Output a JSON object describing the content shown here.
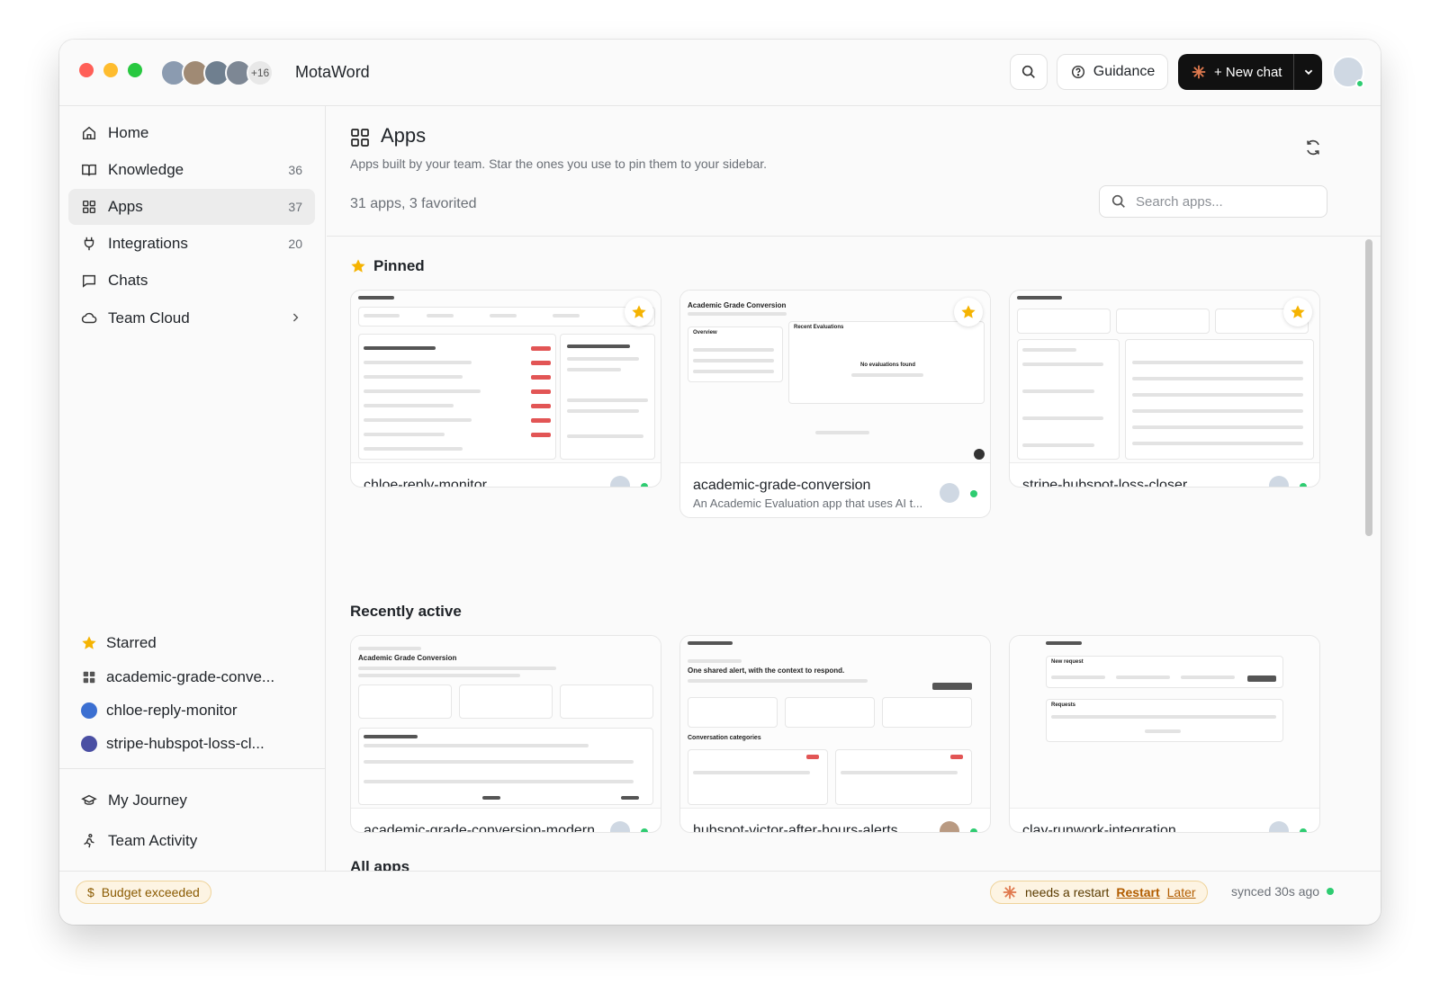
{
  "window": {
    "traffic_lights": [
      "close",
      "minimize",
      "zoom"
    ],
    "team_extra_count": "+16",
    "app_name": "MotaWord"
  },
  "toolbar": {
    "search_icon": "search-icon",
    "guidance_label": "Guidance",
    "new_chat_label": "+ New chat"
  },
  "sidebar": {
    "items": [
      {
        "label": "Home",
        "icon": "home-icon",
        "count": ""
      },
      {
        "label": "Knowledge",
        "icon": "book-icon",
        "count": "36"
      },
      {
        "label": "Apps",
        "icon": "grid-icon",
        "count": "37"
      },
      {
        "label": "Integrations",
        "icon": "plug-icon",
        "count": "20"
      },
      {
        "label": "Chats",
        "icon": "chat-icon",
        "count": ""
      },
      {
        "label": "Team Cloud",
        "icon": "cloud-icon",
        "count": ""
      }
    ],
    "starred_title": "Starred",
    "starred": [
      {
        "label": "academic-grade-conve...",
        "icon": "grid-icon"
      },
      {
        "label": "chloe-reply-monitor",
        "icon": "app-badge-icon"
      },
      {
        "label": "stripe-hubspot-loss-cl...",
        "icon": "app-badge-icon"
      }
    ],
    "bottom": [
      {
        "label": "My Journey",
        "icon": "graduation-cap-icon"
      },
      {
        "label": "Team Activity",
        "icon": "running-person-icon"
      }
    ]
  },
  "main": {
    "title": "Apps",
    "subtitle": "Apps built by your team. Star the ones you use to pin them to your sidebar.",
    "counts": "31 apps, 3 favorited",
    "search_placeholder": "Search apps...",
    "pinned_title": "Pinned",
    "recent_title": "Recently active",
    "all_title": "All apps",
    "pinned": [
      {
        "name": "chloe-reply-monitor",
        "desc": ""
      },
      {
        "name": "academic-grade-conversion",
        "desc": "An Academic Evaluation app that uses AI t..."
      },
      {
        "name": "stripe-hubspot-loss-closer",
        "desc": ""
      }
    ],
    "recent": [
      {
        "name": "academic-grade-conversion-modern"
      },
      {
        "name": "hubspot-victor-after-hours-alerts"
      },
      {
        "name": "clay-runwork-integration"
      }
    ],
    "thumbs": {
      "acad_title": "Academic Grade Conversion",
      "acad_recent": "Recent Evaluations",
      "acad_none": "No evaluations found",
      "acad_overview": "Overview",
      "modern_title": "Academic Grade Conversion",
      "hubspot_header": "One shared alert, with the context to respond.",
      "hubspot_categories": "Conversation categories",
      "clay_new": "New request",
      "clay_requests": "Requests"
    }
  },
  "statusbar": {
    "budget": "Budget exceeded",
    "restart_text": "needs a restart",
    "restart_link": "Restart",
    "later_link": "Later",
    "synced": "synced 30s ago"
  },
  "colors": {
    "accent_dark": "#111111",
    "star": "#f5b301",
    "online": "#2ecc71",
    "warning_bg": "#fdf4e3"
  }
}
